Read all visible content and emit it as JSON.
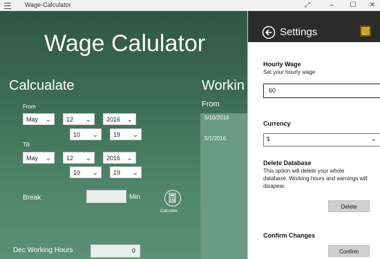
{
  "window": {
    "title": "Wage-Calculator",
    "controls": [
      "⤢",
      "–",
      "☐",
      "✕"
    ]
  },
  "main": {
    "app_title": "Wage Calulator",
    "calc_heading": "Calcualate",
    "working_heading": "Workin",
    "from_label": "From",
    "till_label": "Till",
    "from_month": "May",
    "from_day": "12",
    "from_year": "2016",
    "from_hour": "10",
    "from_minute": "19",
    "till_month": "May",
    "till_day": "12",
    "till_year": "2016",
    "till_hour": "10",
    "till_minute": "19",
    "break_label": "Break",
    "break_value": "",
    "break_unit": "Min",
    "calculate_label": "Calculate",
    "dec_hours_label": "Dec Working Hours",
    "dec_hours_value": "0",
    "list_header": "From",
    "list_items": [
      "5/10/2016",
      "5/1/2016"
    ]
  },
  "settings": {
    "title": "Settings",
    "hourly_wage_heading": "Hourly Wage",
    "hourly_wage_desc": "Set your hourly wage",
    "hourly_wage_value": "60",
    "currency_heading": "Currency",
    "currency_value": "$",
    "delete_heading": "Delete Database",
    "delete_desc_1": "This option will delete your whole",
    "delete_desc_2": "database. Working hours and earnings will",
    "delete_desc_3": "disapear.",
    "delete_button": "Delete",
    "confirm_heading": "Confirm Changes",
    "confirm_button": "Confirm"
  },
  "icons": {
    "menu": "hamburger-icon",
    "back": "back-arrow-icon",
    "calculator": "calculator-icon",
    "chevron": "chevron-down-icon"
  },
  "colors": {
    "panel_top": "#2f5645",
    "panel_bottom": "#5b9076",
    "settings_header": "#2b2b2b",
    "button_gray": "#cfcfcf"
  }
}
